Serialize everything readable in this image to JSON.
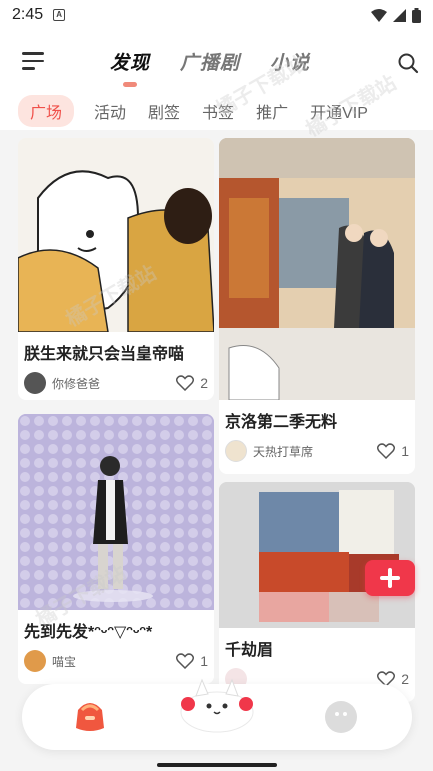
{
  "status_bar": {
    "time": "2:45",
    "notification_badge": "A"
  },
  "header": {
    "tabs": [
      {
        "label": "发现",
        "active": true
      },
      {
        "label": "广播剧",
        "active": false
      },
      {
        "label": "小说",
        "active": false
      }
    ]
  },
  "sub_tabs": [
    {
      "label": "广场",
      "active": true
    },
    {
      "label": "活动",
      "active": false
    },
    {
      "label": "剧签",
      "active": false
    },
    {
      "label": "书签",
      "active": false
    },
    {
      "label": "推广",
      "active": false
    },
    {
      "label": "开通VIP",
      "active": false
    }
  ],
  "cards": [
    {
      "title": "朕生来就只会当皇帝喵",
      "author": "你修爸爸",
      "likes": "2"
    },
    {
      "title": "京洛第二季无料",
      "author": "天热打草席",
      "likes": "1"
    },
    {
      "title": "先到先发*ᵔᵕᵔ▽ᵔᵕᵔ*",
      "author": "喵宝",
      "likes": "1"
    },
    {
      "title": "千劫眉",
      "author": "",
      "likes": "2"
    }
  ],
  "watermark": "橘子下载站",
  "colors": {
    "accent": "#f0504a",
    "add_button": "#f0374a",
    "active_tab_indicator": "#f08a7a"
  }
}
